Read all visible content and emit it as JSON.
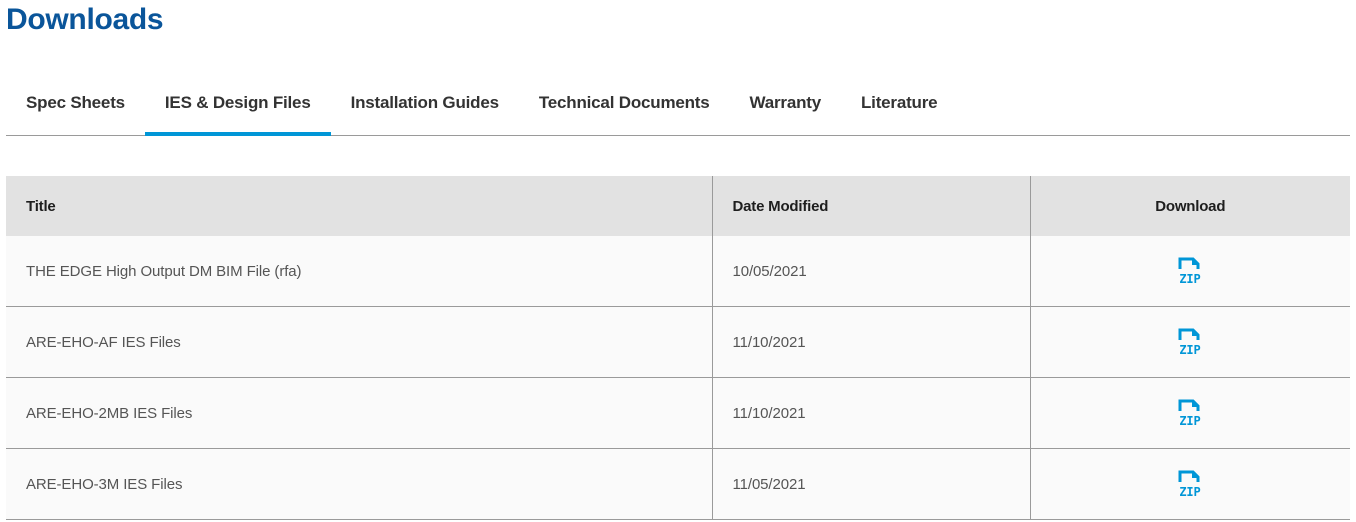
{
  "page": {
    "title": "Downloads"
  },
  "tabs": [
    {
      "label": "Spec Sheets",
      "active": false
    },
    {
      "label": "IES & Design Files",
      "active": true
    },
    {
      "label": "Installation Guides",
      "active": false
    },
    {
      "label": "Technical Documents",
      "active": false
    },
    {
      "label": "Warranty",
      "active": false
    },
    {
      "label": "Literature",
      "active": false
    }
  ],
  "table": {
    "headers": {
      "title": "Title",
      "date_modified": "Date Modified",
      "download": "Download"
    },
    "rows": [
      {
        "title": "THE EDGE High Output DM BIM File (rfa)",
        "date_modified": "10/05/2021",
        "download_icon": "zip-file-icon",
        "download_label": "ZIP"
      },
      {
        "title": "ARE-EHO-AF IES Files",
        "date_modified": "11/10/2021",
        "download_icon": "zip-file-icon",
        "download_label": "ZIP"
      },
      {
        "title": "ARE-EHO-2MB IES Files",
        "date_modified": "11/10/2021",
        "download_icon": "zip-file-icon",
        "download_label": "ZIP"
      },
      {
        "title": "ARE-EHO-3M IES Files",
        "date_modified": "11/05/2021",
        "download_icon": "zip-file-icon",
        "download_label": "ZIP"
      }
    ]
  },
  "colors": {
    "heading": "#0a559a",
    "accent": "#0096d7",
    "header_bg": "#e2e2e2",
    "row_bg": "#fafafa",
    "border": "#9a9a9a"
  }
}
